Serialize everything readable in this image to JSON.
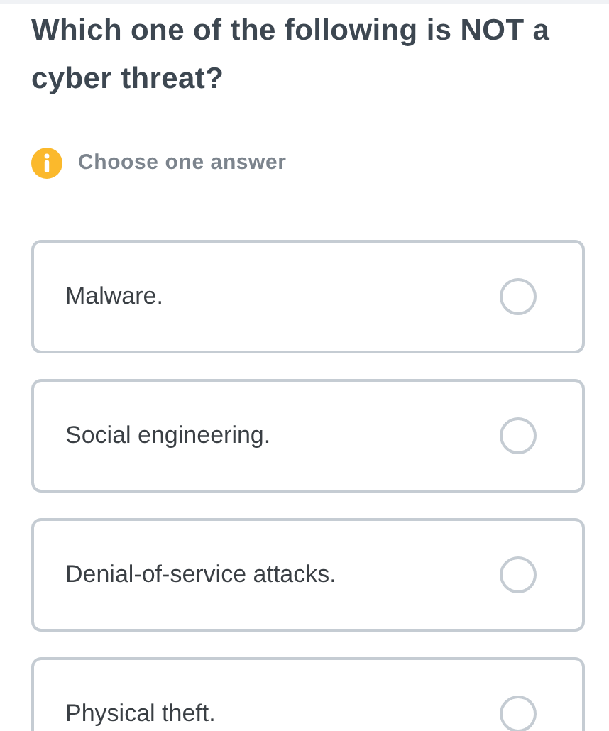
{
  "question": "Which one of the following is NOT a cyber threat?",
  "hint": "Choose one answer",
  "options": [
    {
      "label": "Malware.",
      "selected": false
    },
    {
      "label": "Social engineering.",
      "selected": false
    },
    {
      "label": "Denial-of-service attacks.",
      "selected": false
    },
    {
      "label": "Physical theft.",
      "selected": false
    }
  ]
}
